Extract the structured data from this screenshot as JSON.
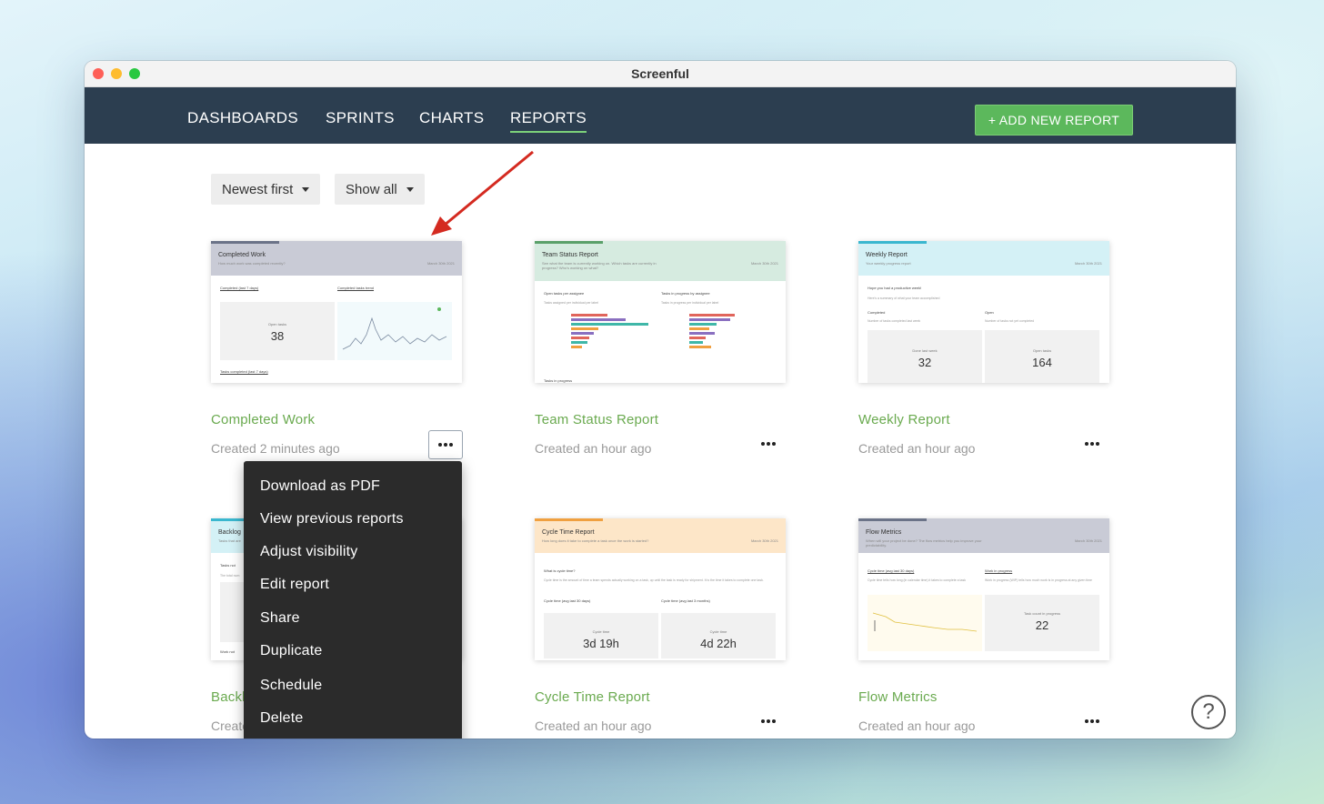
{
  "window": {
    "title": "Screenful"
  },
  "nav": {
    "items": [
      "DASHBOARDS",
      "SPRINTS",
      "CHARTS",
      "REPORTS"
    ],
    "active": "REPORTS",
    "add_button": "+ ADD NEW REPORT"
  },
  "filters": {
    "sort": "Newest first",
    "visibility": "Show all"
  },
  "reports": [
    {
      "name": "Completed Work",
      "created": "Created 2 minutes ago",
      "preview": {
        "title": "Completed Work",
        "subtitle": "How much work was completed recently?",
        "date": "March 30th 2021",
        "left_section": "Completed (last 7 days)",
        "right_section": "Completed tasks trend",
        "kpi_label": "Open tasks",
        "kpi_value": "38",
        "footer": "Tasks completed (last 7 days)",
        "accent": "#6b7388",
        "head_bg": "#c9cbd6"
      }
    },
    {
      "name": "Team Status Report",
      "created": "Created an hour ago",
      "preview": {
        "title": "Team Status Report",
        "subtitle": "See what the team is currently working on. Which tasks are currently in progress? Who's working on what?",
        "date": "March 30th 2021",
        "left_section": "Open tasks per assignee",
        "right_section": "Tasks in progress by assignee",
        "left_note": "Tasks assigned per individual per label",
        "right_note": "Tasks in progress per individual per label",
        "footer": "Tasks in progress",
        "accent": "#5aa06a",
        "head_bg": "#d6ebe0"
      }
    },
    {
      "name": "Weekly Report",
      "created": "Created an hour ago",
      "preview": {
        "title": "Weekly Report",
        "subtitle": "Your weekly progress report",
        "date": "March 30th 2021",
        "intro": "Hope you had a productive week!",
        "intro_note": "Here's a summary of what your team accomplished",
        "left_section": "Completed",
        "left_note": "Number of tasks completed last week",
        "right_section": "Open",
        "right_note": "Number of tasks not yet completed",
        "kpi1_label": "Done last week",
        "kpi1_value": "32",
        "kpi2_label": "Open tasks",
        "kpi2_value": "164",
        "accent": "#3ab7cf",
        "head_bg": "#d4f1f6"
      }
    },
    {
      "name": "Backlog",
      "created": "Created an hour ago",
      "preview": {
        "title": "Backlog",
        "subtitle": "Tasks that are",
        "section": "Tasks not",
        "note": "The total num",
        "footer": "Work not",
        "accent": "#3ab7cf",
        "head_bg": "#d4f1f6"
      }
    },
    {
      "name": "Cycle Time Report",
      "created": "Created an hour ago",
      "preview": {
        "title": "Cycle Time Report",
        "subtitle": "How long does it take to complete a task once the work is started?",
        "date": "March 30th 2021",
        "q_title": "What is cycle time?",
        "q_text": "Cycle time is the amount of time a team spends actually working on a task, up until the task is ready for shipment. It is the time it takes to complete one task.",
        "left_section": "Cycle time (avg last 30 days)",
        "right_section": "Cycle time (avg last 3 months)",
        "kpi1_label": "Cycle time",
        "kpi1_value": "3d 19h",
        "kpi2_label": "Cycle time",
        "kpi2_value": "4d 22h",
        "accent": "#f0a040",
        "head_bg": "#fde6c8"
      }
    },
    {
      "name": "Flow Metrics",
      "created": "Created an hour ago",
      "preview": {
        "title": "Flow Metrics",
        "subtitle": "When will your project be done? The flow metrics help you improve your predictability.",
        "date": "March 30th 2021",
        "left_section": "Cycle time (avg last 30 days)",
        "left_note": "Cycle time tells how long (in calendar time) it takes to complete a task",
        "right_section": "Work in progress",
        "right_note": "Work in progress (WIP) tells how much work is in progress at any given time",
        "kpi_label": "Task count in progress",
        "kpi_value": "22",
        "accent": "#6b7388",
        "head_bg": "#c9cbd6"
      }
    }
  ],
  "context_menu": {
    "items": [
      "Download as PDF",
      "View previous reports",
      "Adjust visibility",
      "Edit report",
      "Share",
      "Duplicate",
      "Schedule",
      "Delete"
    ]
  },
  "help": {
    "label": "?"
  },
  "colors": {
    "nav_bg": "#2c3e50",
    "accent_green": "#5cb85c",
    "report_name": "#6aaa4f",
    "menu_bg": "#2b2b2b"
  },
  "icons": {
    "more": "ellipsis-icon",
    "caret": "caret-down-icon",
    "help": "question-circle-icon"
  }
}
